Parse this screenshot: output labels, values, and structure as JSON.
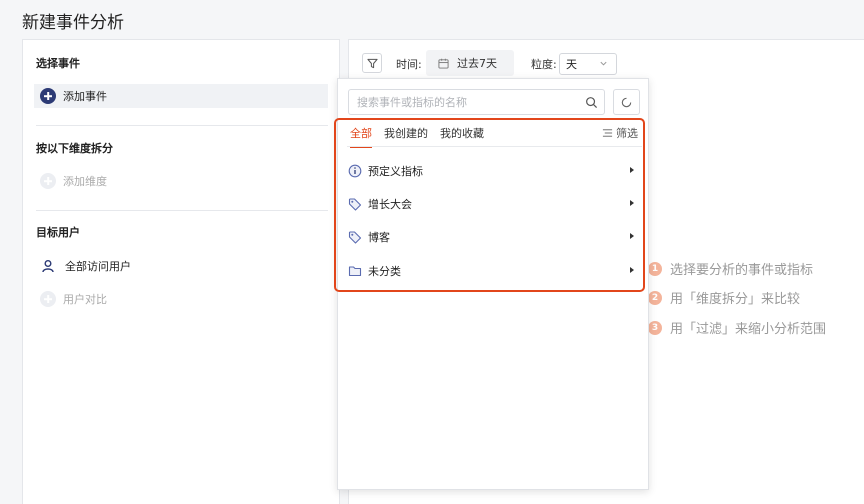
{
  "page": {
    "title": "新建事件分析"
  },
  "left": {
    "select_event_title": "选择事件",
    "add_event_label": "添加事件",
    "dimension_title": "按以下维度拆分",
    "add_dimension_label": "添加维度",
    "target_user_title": "目标用户",
    "all_users_label": "全部访问用户",
    "user_compare_label": "用户对比"
  },
  "toolbar": {
    "time_label": "时间:",
    "time_value": "过去7天",
    "granularity_label": "粒度:",
    "granularity_value": "天"
  },
  "dropdown": {
    "search_placeholder": "搜索事件或指标的名称",
    "tabs": [
      {
        "label": "全部",
        "active": true
      },
      {
        "label": "我创建的",
        "active": false
      },
      {
        "label": "我的收藏",
        "active": false
      }
    ],
    "filter_label": "筛选",
    "categories": [
      {
        "label": "预定义指标",
        "icon": "info-icon"
      },
      {
        "label": "增长大会",
        "icon": "tag-icon"
      },
      {
        "label": "博客",
        "icon": "tag-icon"
      },
      {
        "label": "未分类",
        "icon": "folder-icon"
      }
    ]
  },
  "hints": [
    {
      "num": "1",
      "text": "选择要分析的事件或指标"
    },
    {
      "num": "2",
      "text": "用「维度拆分」来比较"
    },
    {
      "num": "3",
      "text": "用「过滤」来缩小分析范围"
    }
  ],
  "colors": {
    "accent": "#e2461b",
    "primary": "#2c3a75",
    "hint_badge": "#f4b49b"
  }
}
